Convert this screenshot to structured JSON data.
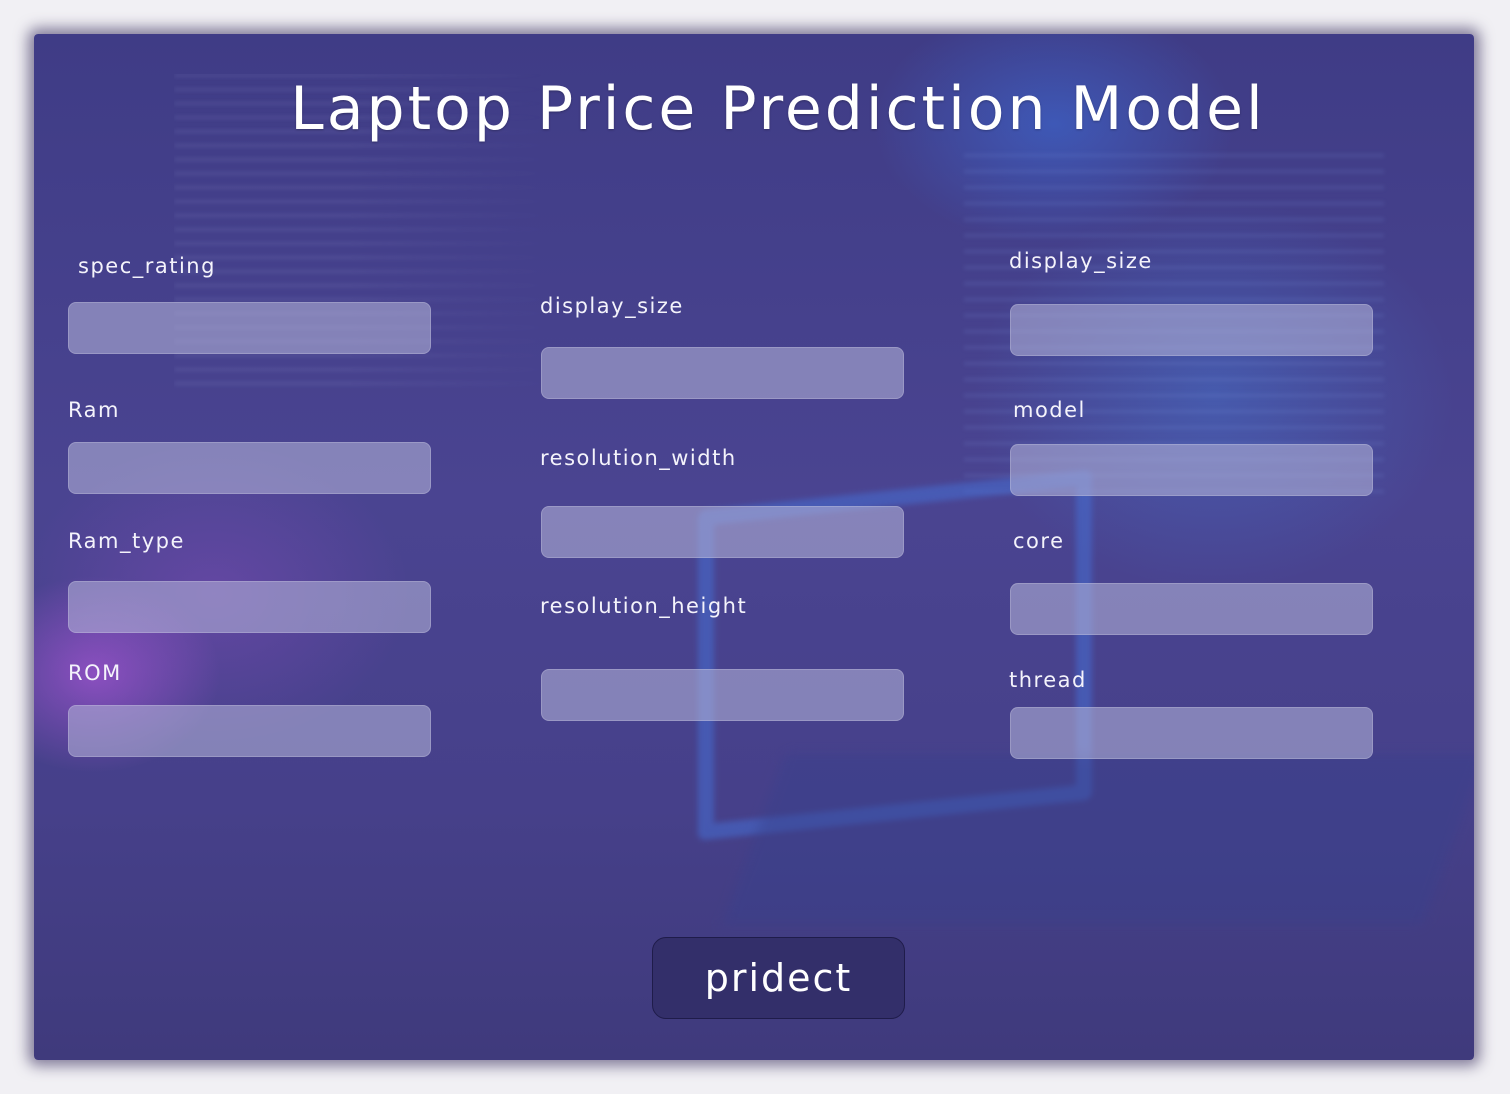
{
  "title": "Laptop Price Prediction Model",
  "fields": {
    "spec_rating": {
      "label": "spec_rating",
      "value": ""
    },
    "ram": {
      "label": "Ram",
      "value": ""
    },
    "ram_type": {
      "label": "Ram_type",
      "value": ""
    },
    "rom": {
      "label": "ROM",
      "value": ""
    },
    "display_size_mid": {
      "label": "display_size",
      "value": ""
    },
    "resolution_width": {
      "label": "resolution_width",
      "value": ""
    },
    "resolution_height": {
      "label": "resolution_height",
      "value": ""
    },
    "display_size_right": {
      "label": "display_size",
      "value": ""
    },
    "model": {
      "label": "model",
      "value": ""
    },
    "core": {
      "label": "core",
      "value": ""
    },
    "thread": {
      "label": "thread",
      "value": ""
    }
  },
  "predict_button": {
    "label": "pridect"
  },
  "colors": {
    "background": "#46408a",
    "input_fill": "#a9a8d3",
    "button": "#332f6a",
    "text": "#ffffff"
  }
}
